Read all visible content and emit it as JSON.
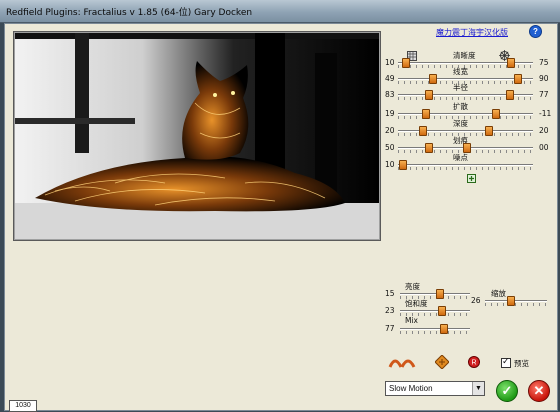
{
  "window": {
    "title": "Redfield Plugins: Fractalius v 1.85 (64-位)   Gary Docken"
  },
  "header": {
    "link_text": "魔力震丁海宇汉化版",
    "help_label": "?"
  },
  "top_params": [
    {
      "label": "清晰度",
      "left_value": "10",
      "right_value": "75",
      "left_frac": 0.05,
      "right_frac": 0.83
    },
    {
      "label": "线宽",
      "left_value": "49",
      "right_value": "90",
      "left_frac": 0.25,
      "right_frac": 0.88
    },
    {
      "label": "半径",
      "left_value": "83",
      "right_value": "77",
      "left_frac": 0.22,
      "right_frac": 0.82
    },
    {
      "label": "扩散",
      "left_value": "19",
      "right_value": "-11",
      "left_frac": 0.2,
      "right_frac": 0.72
    },
    {
      "label": "深度",
      "left_value": "20",
      "right_value": "20",
      "left_frac": 0.18,
      "right_frac": 0.67
    },
    {
      "label": "划痕",
      "left_value": "50",
      "right_value": "00",
      "left_frac": 0.22,
      "right_frac": 0.5
    },
    {
      "label": "噪点",
      "left_value": "10",
      "right_value": "",
      "left_frac": 0.03,
      "right_frac": null
    }
  ],
  "bottom_params": [
    {
      "label": "亮度",
      "value": "15",
      "frac": 0.55
    },
    {
      "label": "饱和度",
      "value": "23",
      "frac": 0.58
    },
    {
      "label": "Mix",
      "value": "77",
      "frac": 0.62
    }
  ],
  "zoom_param": {
    "label": "缩放",
    "value": "26",
    "frac": 0.4
  },
  "preview_checkbox": {
    "label": "预览",
    "checked": true
  },
  "blend_mode": {
    "selected": "Slow Motion"
  },
  "status": {
    "value": "1030"
  }
}
